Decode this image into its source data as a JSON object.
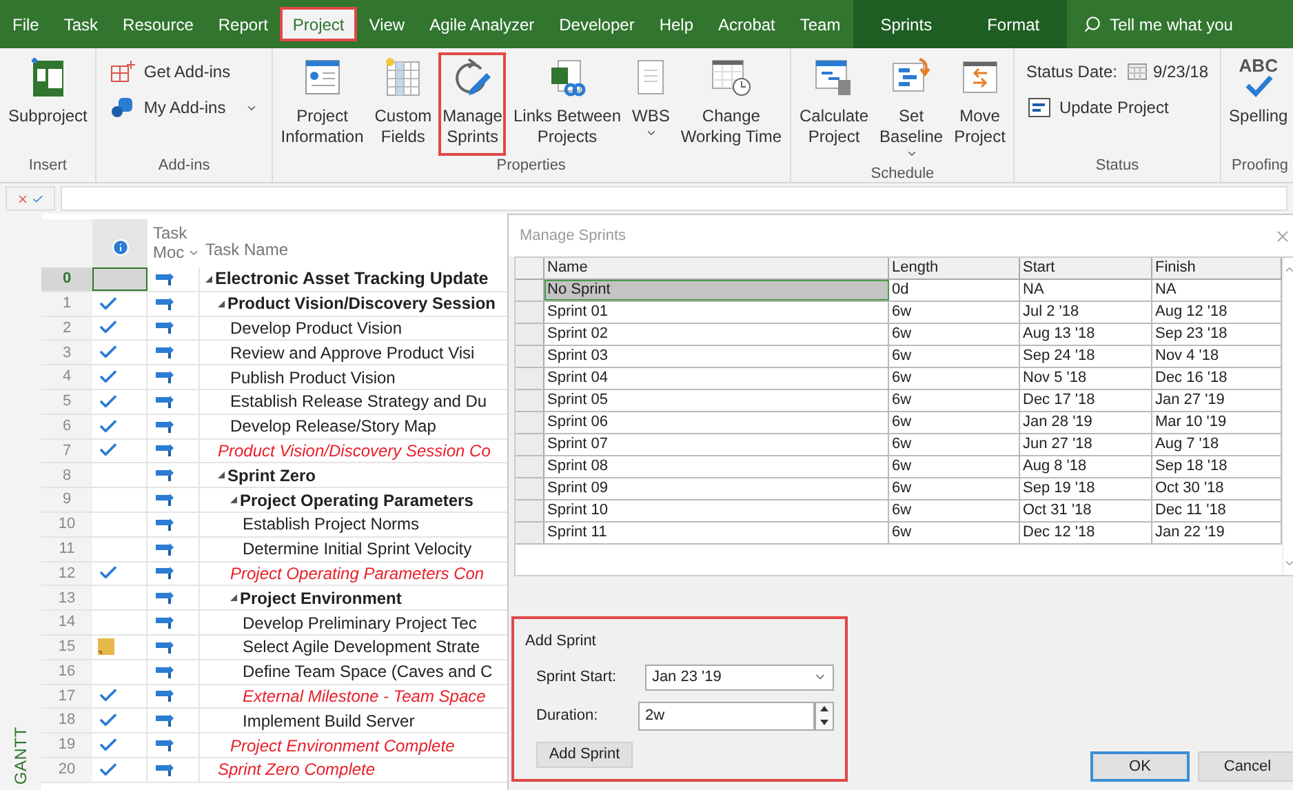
{
  "tabs": [
    {
      "label": "File",
      "kind": "normal",
      "selected": false,
      "highlighted": false
    },
    {
      "label": "Task",
      "kind": "normal",
      "selected": false,
      "highlighted": false
    },
    {
      "label": "Resource",
      "kind": "normal",
      "selected": false,
      "highlighted": false
    },
    {
      "label": "Report",
      "kind": "normal",
      "selected": false,
      "highlighted": false
    },
    {
      "label": "Project",
      "kind": "normal",
      "selected": true,
      "highlighted": true
    },
    {
      "label": "View",
      "kind": "normal",
      "selected": false,
      "highlighted": false
    },
    {
      "label": "Agile Analyzer",
      "kind": "normal",
      "selected": false,
      "highlighted": false
    },
    {
      "label": "Developer",
      "kind": "normal",
      "selected": false,
      "highlighted": false
    },
    {
      "label": "Help",
      "kind": "normal",
      "selected": false,
      "highlighted": false
    },
    {
      "label": "Acrobat",
      "kind": "normal",
      "selected": false,
      "highlighted": false
    },
    {
      "label": "Team",
      "kind": "normal",
      "selected": false,
      "highlighted": false
    },
    {
      "label": "Sprints",
      "kind": "contextual",
      "selected": false,
      "highlighted": false
    },
    {
      "label": "Format",
      "kind": "contextual",
      "selected": false,
      "highlighted": false
    }
  ],
  "tell_me": "Tell me what you",
  "ribbon": [
    {
      "label": "Insert",
      "items": [
        {
          "lines": [
            "Subproject"
          ],
          "kind": "large",
          "dropdown": false,
          "highlighted": false
        }
      ]
    },
    {
      "label": "Add-ins",
      "items": [
        {
          "lines": [
            "Get Add-ins"
          ],
          "kind": "small",
          "dropdown": false,
          "highlighted": false
        },
        {
          "lines": [
            "My Add-ins"
          ],
          "kind": "small",
          "dropdown": true,
          "highlighted": false
        }
      ]
    },
    {
      "label": "Properties",
      "items": [
        {
          "lines": [
            "Project",
            "Information"
          ],
          "kind": "large",
          "dropdown": false,
          "highlighted": false
        },
        {
          "lines": [
            "Custom",
            "Fields"
          ],
          "kind": "large",
          "dropdown": false,
          "highlighted": false
        },
        {
          "lines": [
            "Manage",
            "Sprints"
          ],
          "kind": "large",
          "dropdown": false,
          "highlighted": true
        },
        {
          "lines": [
            "Links Between",
            "Projects"
          ],
          "kind": "large",
          "dropdown": false,
          "highlighted": false
        },
        {
          "lines": [
            "WBS"
          ],
          "kind": "large",
          "dropdown": true,
          "highlighted": false
        },
        {
          "lines": [
            "Change",
            "Working Time"
          ],
          "kind": "large",
          "dropdown": false,
          "highlighted": false
        }
      ]
    },
    {
      "label": "Schedule",
      "items": [
        {
          "lines": [
            "Calculate",
            "Project"
          ],
          "kind": "large",
          "dropdown": false,
          "highlighted": false
        },
        {
          "lines": [
            "Set",
            "Baseline"
          ],
          "kind": "large",
          "dropdown": true,
          "highlighted": false
        },
        {
          "lines": [
            "Move",
            "Project"
          ],
          "kind": "large",
          "dropdown": false,
          "highlighted": false
        }
      ]
    },
    {
      "label": "Status",
      "items": [
        {
          "lines": [
            "Status Date:"
          ],
          "value": "9/23/18",
          "kind": "date"
        },
        {
          "lines": [
            "Update Project"
          ],
          "kind": "small",
          "dropdown": false,
          "highlighted": false
        }
      ]
    },
    {
      "label": "Proofing",
      "items": [
        {
          "lines": [
            "Spelling"
          ],
          "badge": "ABC",
          "kind": "large",
          "dropdown": false,
          "highlighted": false
        }
      ]
    }
  ],
  "view_bar": "GANTT",
  "grid": {
    "mode_header": [
      "Task",
      "Moc"
    ],
    "name_header": "Task Name",
    "rows": [
      {
        "id": "0",
        "name": "Electronic Asset Tracking Update",
        "kind": "summary",
        "complete": false,
        "note": false,
        "selected": true,
        "children": [
          {
            "id": "1",
            "name": "Product Vision/Discovery Session",
            "kind": "summary",
            "complete": true,
            "note": false,
            "selected": false,
            "children": [
              {
                "id": "2",
                "name": "Develop Product Vision",
                "kind": "task",
                "complete": true,
                "note": false,
                "selected": false
              },
              {
                "id": "3",
                "name": "Review and Approve Product Visi",
                "kind": "task",
                "complete": true,
                "note": false,
                "selected": false
              },
              {
                "id": "4",
                "name": "Publish Product Vision",
                "kind": "task",
                "complete": true,
                "note": false,
                "selected": false
              },
              {
                "id": "5",
                "name": "Establish Release Strategy and Du",
                "kind": "task",
                "complete": true,
                "note": false,
                "selected": false
              },
              {
                "id": "6",
                "name": "Develop Release/Story Map",
                "kind": "task",
                "complete": true,
                "note": false,
                "selected": false
              }
            ]
          },
          {
            "id": "7",
            "name": "Product Vision/Discovery Session Co",
            "kind": "milestone",
            "complete": true,
            "note": false,
            "selected": false
          },
          {
            "id": "8",
            "name": "Sprint Zero",
            "kind": "summary",
            "complete": false,
            "note": false,
            "selected": false,
            "children": [
              {
                "id": "9",
                "name": "Project Operating Parameters",
                "kind": "summary",
                "complete": false,
                "note": false,
                "selected": false,
                "children": [
                  {
                    "id": "10",
                    "name": "Establish Project Norms",
                    "kind": "task",
                    "complete": false,
                    "note": false,
                    "selected": false
                  },
                  {
                    "id": "11",
                    "name": "Determine Initial Sprint Velocity",
                    "kind": "task",
                    "complete": false,
                    "note": false,
                    "selected": false
                  }
                ]
              },
              {
                "id": "12",
                "name": "Project Operating Parameters Con",
                "kind": "milestone",
                "complete": true,
                "note": false,
                "selected": false
              },
              {
                "id": "13",
                "name": "Project Environment",
                "kind": "summary",
                "complete": false,
                "note": false,
                "selected": false,
                "children": [
                  {
                    "id": "14",
                    "name": "Develop Preliminary Project Tec",
                    "kind": "task",
                    "complete": false,
                    "note": false,
                    "selected": false
                  },
                  {
                    "id": "15",
                    "name": "Select Agile Development Strate",
                    "kind": "task",
                    "complete": false,
                    "note": true,
                    "selected": false
                  },
                  {
                    "id": "16",
                    "name": "Define Team Space (Caves and C",
                    "kind": "task",
                    "complete": false,
                    "note": false,
                    "selected": false
                  },
                  {
                    "id": "17",
                    "name": "External Milestone - Team Space",
                    "kind": "milestone",
                    "complete": true,
                    "note": false,
                    "selected": false
                  },
                  {
                    "id": "18",
                    "name": "Implement Build Server",
                    "kind": "task",
                    "complete": true,
                    "note": false,
                    "selected": false
                  }
                ]
              },
              {
                "id": "19",
                "name": "Project Environment Complete",
                "kind": "milestone",
                "complete": true,
                "note": false,
                "selected": false
              }
            ]
          },
          {
            "id": "20",
            "name": "Sprint Zero Complete",
            "kind": "milestone",
            "complete": true,
            "note": false,
            "selected": false
          }
        ]
      }
    ]
  },
  "dialog": {
    "title": "Manage Sprints",
    "columns": [
      "Name",
      "Length",
      "Start",
      "Finish"
    ],
    "rows": [
      {
        "cells": [
          "No Sprint",
          "0d",
          "NA",
          "NA"
        ],
        "selected": true
      },
      {
        "cells": [
          "Sprint 01",
          "6w",
          "Jul 2 '18",
          "Aug 12 '18"
        ],
        "selected": false
      },
      {
        "cells": [
          "Sprint 02",
          "6w",
          "Aug 13 '18",
          "Sep 23 '18"
        ],
        "selected": false
      },
      {
        "cells": [
          "Sprint 03",
          "6w",
          "Sep 24 '18",
          "Nov 4 '18"
        ],
        "selected": false
      },
      {
        "cells": [
          "Sprint 04",
          "6w",
          "Nov 5 '18",
          "Dec 16 '18"
        ],
        "selected": false
      },
      {
        "cells": [
          "Sprint 05",
          "6w",
          "Dec 17 '18",
          "Jan 27 '19"
        ],
        "selected": false
      },
      {
        "cells": [
          "Sprint 06",
          "6w",
          "Jan 28 '19",
          "Mar 10 '19"
        ],
        "selected": false
      },
      {
        "cells": [
          "Sprint 07",
          "6w",
          "Jun 27 '18",
          "Aug 7 '18"
        ],
        "selected": false
      },
      {
        "cells": [
          "Sprint 08",
          "6w",
          "Aug 8 '18",
          "Sep 18 '18"
        ],
        "selected": false
      },
      {
        "cells": [
          "Sprint 09",
          "6w",
          "Sep 19 '18",
          "Oct 30 '18"
        ],
        "selected": false
      },
      {
        "cells": [
          "Sprint 10",
          "6w",
          "Oct 31 '18",
          "Dec 11 '18"
        ],
        "selected": false
      },
      {
        "cells": [
          "Sprint 11",
          "6w",
          "Dec 12 '18",
          "Jan 22 '19"
        ],
        "selected": false
      }
    ],
    "add": {
      "title": "Add Sprint",
      "highlighted": true,
      "fields": [
        {
          "label": "Sprint Start:",
          "value": "Jan 23 '19",
          "kind": "dropdown"
        },
        {
          "label": "Duration:",
          "value": "2w",
          "kind": "spinner"
        }
      ],
      "button": "Add Sprint"
    },
    "buttons": [
      {
        "label": "OK",
        "default": true
      },
      {
        "label": "Cancel",
        "default": false
      }
    ]
  }
}
